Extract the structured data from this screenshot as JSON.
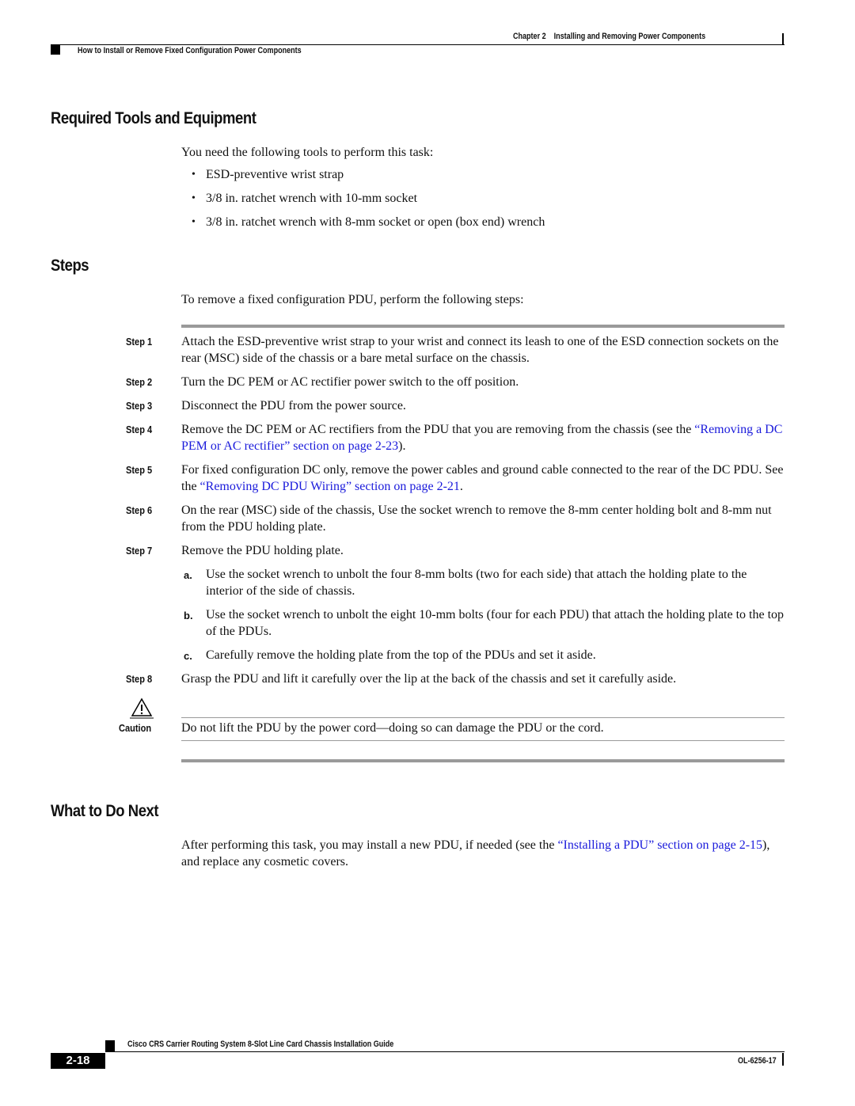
{
  "header": {
    "chapter": "Chapter 2",
    "chapter_title": "Installing and Removing Power Components",
    "section": "How to Install or Remove Fixed Configuration Power Components"
  },
  "sections": {
    "tools": {
      "title": "Required Tools and Equipment",
      "intro": "You need the following tools to perform this task:",
      "items": [
        "ESD-preventive wrist strap",
        "3/8 in. ratchet wrench with 10-mm socket",
        "3/8 in. ratchet wrench with 8-mm socket or open (box end) wrench"
      ]
    },
    "steps": {
      "title": "Steps",
      "intro": "To remove a fixed configuration PDU, perform the following steps:",
      "list": [
        {
          "label": "Step 1",
          "text": "Attach the ESD-preventive wrist strap to your wrist and connect its leash to one of the ESD connection sockets on the rear (MSC) side of the chassis or a bare metal surface on the chassis."
        },
        {
          "label": "Step 2",
          "text": "Turn the DC PEM or AC rectifier power switch to the off position."
        },
        {
          "label": "Step 3",
          "text": "Disconnect the PDU from the power source."
        },
        {
          "label": "Step 4",
          "text_before": "Remove the DC PEM or AC rectifiers from the PDU that you are removing from the chassis (see the ",
          "link": "“Removing a DC PEM or AC rectifier” section on page 2-23",
          "text_after": ")."
        },
        {
          "label": "Step 5",
          "text_before": "For fixed configuration DC only, remove the power cables and ground cable connected to the rear of the DC PDU. See the ",
          "link": "“Removing DC PDU Wiring” section on page 2-21",
          "text_after": "."
        },
        {
          "label": "Step 6",
          "text": "On the rear (MSC) side of the chassis, Use the socket wrench to remove the 8-mm center holding bolt and 8-mm nut from the PDU holding plate."
        },
        {
          "label": "Step 7",
          "text": "Remove the PDU holding plate.",
          "substeps": [
            {
              "label": "a.",
              "text": "Use the socket wrench to unbolt the four 8-mm bolts (two for each side) that attach the holding plate to the interior of the side of chassis."
            },
            {
              "label": "b.",
              "text": "Use the socket wrench to unbolt the eight 10-mm bolts (four for each PDU) that attach the holding plate to the top of the PDUs."
            },
            {
              "label": "c.",
              "text": "Carefully remove the holding plate from the top of the PDUs and set it aside."
            }
          ]
        },
        {
          "label": "Step 8",
          "text": "Grasp the PDU and lift it carefully over the lip at the back of the chassis and set it carefully aside."
        }
      ],
      "caution": {
        "label": "Caution",
        "text": "Do not lift the PDU by the power cord—doing so can damage the PDU or the cord."
      }
    },
    "next": {
      "title": "What to Do Next",
      "text_before": "After performing this task, you may install a new PDU, if needed (see the ",
      "link": "“Installing a PDU” section on page 2-15",
      "text_after": "), and replace any cosmetic covers."
    }
  },
  "footer": {
    "book_title": "Cisco CRS Carrier Routing System 8-Slot Line Card Chassis Installation Guide",
    "page_number": "2-18",
    "doc_number": "OL-6256-17"
  }
}
